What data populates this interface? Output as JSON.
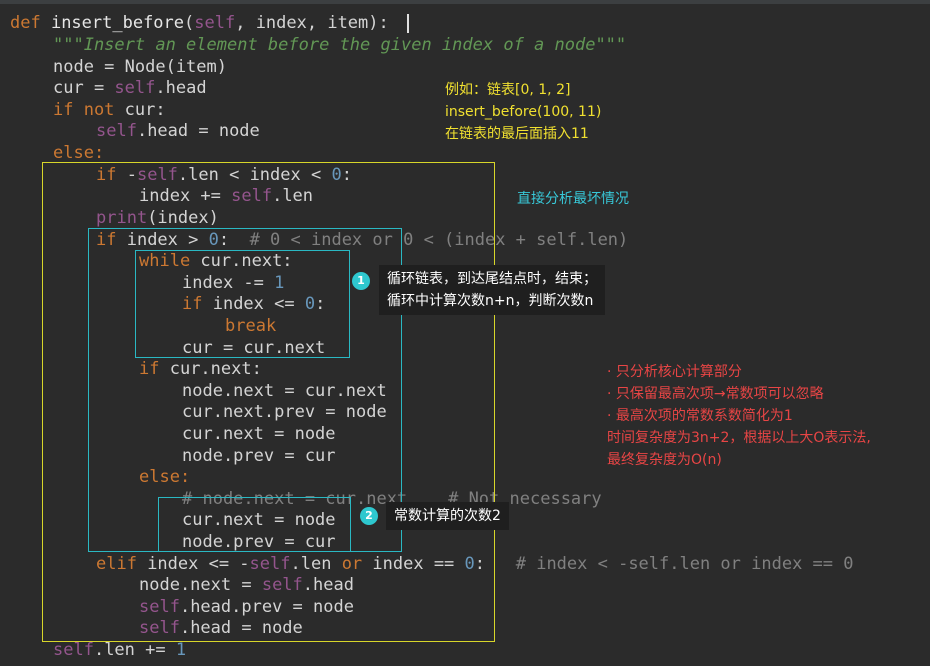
{
  "code": {
    "l1": {
      "def": "def ",
      "name": "insert_before",
      "p1": "(",
      "self": "self",
      "p2": ", index, item):"
    },
    "l2": {
      "doc": "\"\"\"Insert an element before the given index of a node\"\"\""
    },
    "l3": {
      "t": "node = Node(item)"
    },
    "l4": {
      "a": "cur = ",
      "self": "self",
      ".b": ".head"
    },
    "l5": {
      "kw": "if not ",
      "b": "cur:"
    },
    "l6": {
      "self": "self",
      "b": ".head = node"
    },
    "l7": {
      "kw": "else:"
    },
    "l8": {
      "kw": "if ",
      "a": "-",
      "self": "self",
      "b": ".len < index < ",
      "num": "0",
      ":": ":"
    },
    "l9": {
      "a": "index += ",
      "self": "self",
      "b": ".len"
    },
    "l10": {
      "kw": "print",
      "b": "(index)"
    },
    "l11": {
      "kw": "if ",
      "a": "index > ",
      "num": "0",
      ":": ":  ",
      "cm": "# 0 < index or 0 < (index + self.len)"
    },
    "l12": {
      "kw": "while ",
      "b": "cur.next:"
    },
    "l13": {
      "a": "index -= ",
      "num": "1"
    },
    "l14": {
      "kw": "if ",
      "a": "index <= ",
      "num": "0",
      ":": ":"
    },
    "l15": {
      "kw": "break"
    },
    "l16": {
      "t": "cur = cur.next"
    },
    "l17": {
      "kw": "if ",
      "b": "cur.next:"
    },
    "l18": {
      "t": "node.next = cur.next"
    },
    "l19": {
      "t": "cur.next.prev = node"
    },
    "l20": {
      "t": "cur.next = node"
    },
    "l21": {
      "t": "node.prev = cur"
    },
    "l22": {
      "kw": "else:"
    },
    "l23": {
      "cm": "# node.next = cur.next    # Not necessary"
    },
    "l24": {
      "t": "cur.next = node"
    },
    "l25": {
      "t": "node.prev = cur"
    },
    "l26": {
      "kw": "elif ",
      "a": "index <= -",
      "self": "self",
      "b": ".len ",
      "kw2": "or ",
      "c": "index == ",
      "num": "0",
      ":": ":   ",
      "cm": "# index < -self.len or index == 0"
    },
    "l27": {
      "a": "node.next = ",
      "self": "self",
      "b": ".head"
    },
    "l28": {
      "self": "self",
      "b": ".head.prev = node"
    },
    "l29": {
      "self": "self",
      "b": ".head = node"
    },
    "l30": {
      "self": "self",
      "a": ".len += ",
      "num": "1"
    }
  },
  "annotations": {
    "example": [
      "例如：链表[0, 1, 2]",
      "insert_before(100, 11)",
      "在链表的最后面插入11"
    ],
    "worst_case": "直接分析最坏情况",
    "callout1": {
      "badge": "1",
      "lines": [
        "循环链表，到达尾结点时，结束；",
        "循环中计算次数n+n，判断次数n"
      ]
    },
    "callout2": {
      "badge": "2",
      "text": "常数计算的次数2"
    },
    "summary": [
      "· 只分析核心计算部分",
      "· 只保留最高次项→常数项可以忽略",
      "· 最高次项的常数系数简化为1",
      "时间复杂度为3n+2，根据以上大O表示法,",
      "最终复杂度为O(n)"
    ]
  },
  "colors": {
    "background": "#2b2b2b",
    "keyword": "#cc7832",
    "self": "#94558d",
    "number": "#6897bb",
    "comment": "#808080",
    "docstring": "#629755",
    "highlight_yellow": "#d8d62a",
    "highlight_cyan": "#2ab8c3",
    "example_text": "#f0e030",
    "worst_case_text": "#38c8d8",
    "summary_text": "#e84545"
  }
}
